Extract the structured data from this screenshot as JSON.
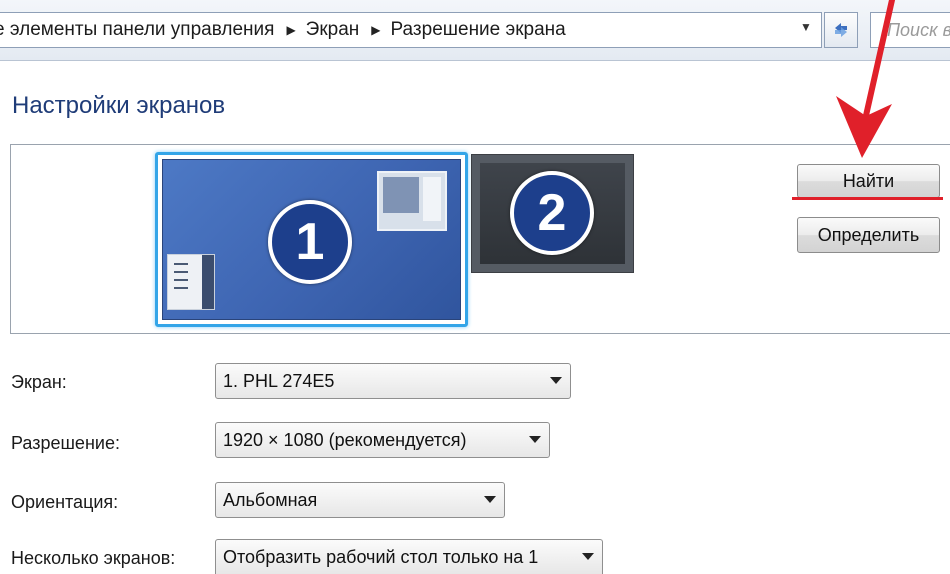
{
  "address_bar": {
    "crumbs": [
      "е элементы панели управления",
      "Экран",
      "Разрешение экрана"
    ],
    "search_placeholder": "Поиск в"
  },
  "page": {
    "title": "Настройки экранов"
  },
  "monitors": [
    {
      "number": "1",
      "selected": true
    },
    {
      "number": "2",
      "selected": false
    }
  ],
  "buttons": {
    "find": "Найти",
    "identify": "Определить"
  },
  "settings": {
    "display": {
      "label": "Экран:",
      "value": "1. PHL 274E5"
    },
    "resolution": {
      "label": "Разрешение:",
      "value": "1920 × 1080 (рекомендуется)"
    },
    "orientation": {
      "label": "Ориентация:",
      "value": "Альбомная"
    },
    "multiple": {
      "label": "Несколько экранов:",
      "value": "Отобразить рабочий стол только на 1"
    }
  },
  "colors": {
    "annotation": "#e0202a",
    "selected_border": "#33a5e8",
    "title": "#1f3c78"
  }
}
